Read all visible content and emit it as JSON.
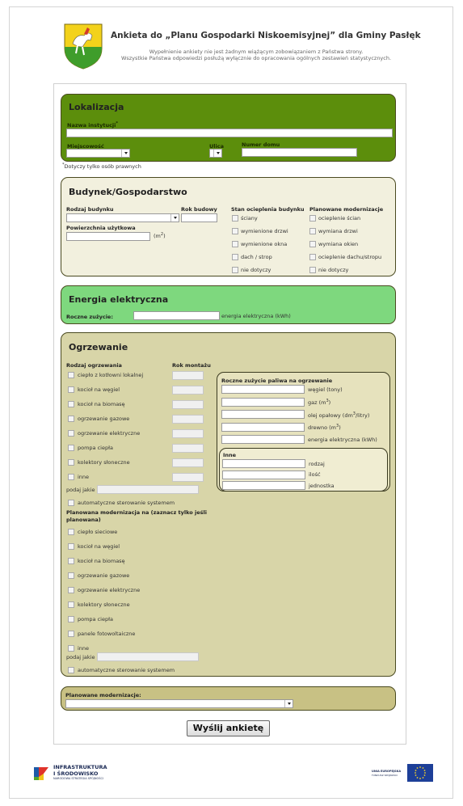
{
  "header": {
    "title": "Ankieta do „Planu Gospodarki Niskoemisyjnej” dla Gminy Pasłęk",
    "subtitle_line1": "Wypełnienie ankiety nie jest żadnym wiążącym zobowiązaniem z Państwa strony.",
    "subtitle_line2": "Wszystkie Państwa odpowiedzi posłużą wyłącznie do opracowania ogólnych zestawień statystycznych."
  },
  "lokalizacja": {
    "title": "Lokalizacja",
    "nazwa_label": "Nazwa instytucji",
    "nazwa_star": "*",
    "miejscowosc_label": "Miejscowość",
    "ulica_label": "Ulica",
    "numer_label": "Numer domu",
    "footnote_star": "*",
    "footnote": "Dotyczy tylko osób prawnych"
  },
  "budynek": {
    "title": "Budynek/Gospodarstwo",
    "rodzaj_label": "Rodzaj budynku",
    "rok_label": "Rok budowy",
    "powierzchnia_label": "Powierzchnia użytkowa",
    "unit_open": "(m",
    "unit_sup": "2",
    "unit_close": ")",
    "stan_label": "Stan ocieplenia budynku",
    "stan_options": [
      "ściany",
      "wymienione drzwi",
      "wymienione okna",
      "dach / strop",
      "nie dotyczy"
    ],
    "plan_label": "Planowane modernizacje",
    "plan_options": [
      "ocieplenie ścian",
      "wymiana drzwi",
      "wymiana okien",
      "ocieplenie dachu/stropu",
      "nie dotyczy"
    ]
  },
  "energia": {
    "title": "Energia elektryczna",
    "label": "Roczne zużycie:",
    "unit": "energia elektryczna (kWh)"
  },
  "ogrzewanie": {
    "title": "Ogrzewanie",
    "rodzaj_label": "Rodzaj ogrzewania",
    "rok_label": "Rok montażu",
    "options": [
      "ciepło z kotłowni lokalnej",
      "kocioł na węgiel",
      "kocioł na biomasę",
      "ogrzewanie gazowe",
      "ogrzewanie elektryczne",
      "pompa ciepła",
      "kolektory słoneczne",
      "inne"
    ],
    "podaj_label": "podaj jakie",
    "auto_label": "automatyczne sterowanie systemem",
    "paliwo_title": "Roczne zużycie paliwa na ogrzewanie",
    "paliwo_units": [
      "węgiel (tony)",
      "gaz (m",
      "olej opałowy (dm",
      "drewno (m",
      "energia elektryczna (kWh)"
    ],
    "paliwo_sup": [
      "",
      "3",
      "3",
      "3",
      ""
    ],
    "paliwo_tail": [
      "",
      ")",
      "/litry)",
      ")",
      ""
    ],
    "inne_title": "Inne",
    "inne_fields": [
      "rodzaj",
      "ilość",
      "jednostka"
    ],
    "plan_label_1": "Planowana modernizacja na (zaznacz tylko jeśli",
    "plan_label_2": "planowana)",
    "plan_options": [
      "ciepło sieciowe",
      "kocioł na węgiel",
      "kocioł na biomasę",
      "ogrzewanie gazowe",
      "ogrzewanie elektryczne",
      "kolektory słoneczne",
      "pompa ciepła",
      "panele fotowoltaiczne",
      "inne"
    ],
    "plan_podaj": "podaj jakie",
    "plan_auto": "automatyczne sterowanie systemem"
  },
  "planowane": {
    "label": "Planowane modernizacje:"
  },
  "submit_label": "Wyślij ankietę",
  "footer": {
    "left_line1": "INFRASTRUKTURA",
    "left_line2": "I ŚRODOWISKO",
    "left_line3": "NARODOWA STRATEGIA SPÓJNOŚCI",
    "right_line1": "UNIA EUROPEJSKA",
    "right_line2": "FUNDUSZ SPÓJNOŚCI"
  },
  "colors": {
    "lokalizacja_bg": "#5c8e0c",
    "budynek_bg": "#f2f0de",
    "energia_bg": "#7ed87e",
    "ogrzewanie_bg": "#d8d5a8",
    "planowane_bg": "#c8c184"
  }
}
